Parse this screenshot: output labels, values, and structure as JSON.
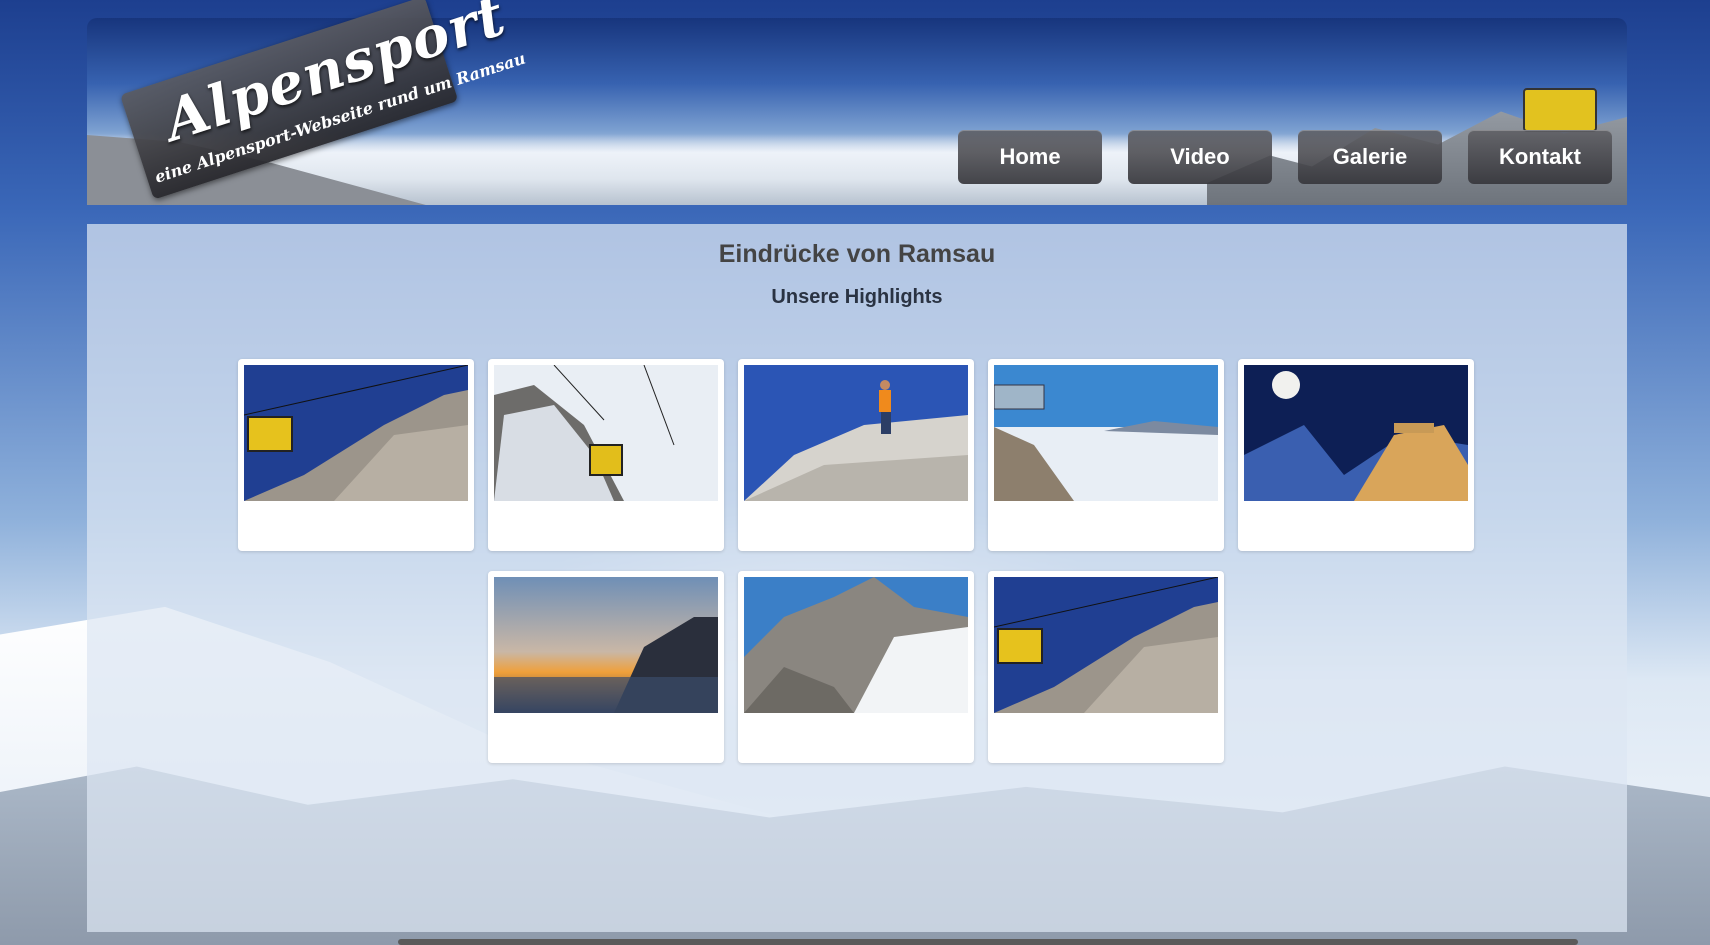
{
  "header": {
    "logo_title": "Alpensport",
    "logo_subtitle": "eine Alpensport-Webseite rund um Ramsau"
  },
  "nav": {
    "items": [
      {
        "label": "Home"
      },
      {
        "label": "Video"
      },
      {
        "label": "Galerie"
      },
      {
        "label": "Kontakt"
      }
    ]
  },
  "main": {
    "title": "Eindrücke von Ramsau",
    "subtitle": "Unsere Highlights"
  },
  "gallery": {
    "images": [
      {
        "icon": "cable-car-rock-photo"
      },
      {
        "icon": "gondola-fog-photo"
      },
      {
        "icon": "climber-summit-photo"
      },
      {
        "icon": "skywalk-platform-photo"
      },
      {
        "icon": "moon-night-peak-photo"
      },
      {
        "icon": "sunset-valley-photo"
      },
      {
        "icon": "glacier-station-photo"
      },
      {
        "icon": "cable-car-rock-photo"
      }
    ]
  },
  "colors": {
    "nav_bg": "#4a4a4f",
    "title": "#444444",
    "subtitle": "#2a3343",
    "panel": "#dce6f2"
  }
}
